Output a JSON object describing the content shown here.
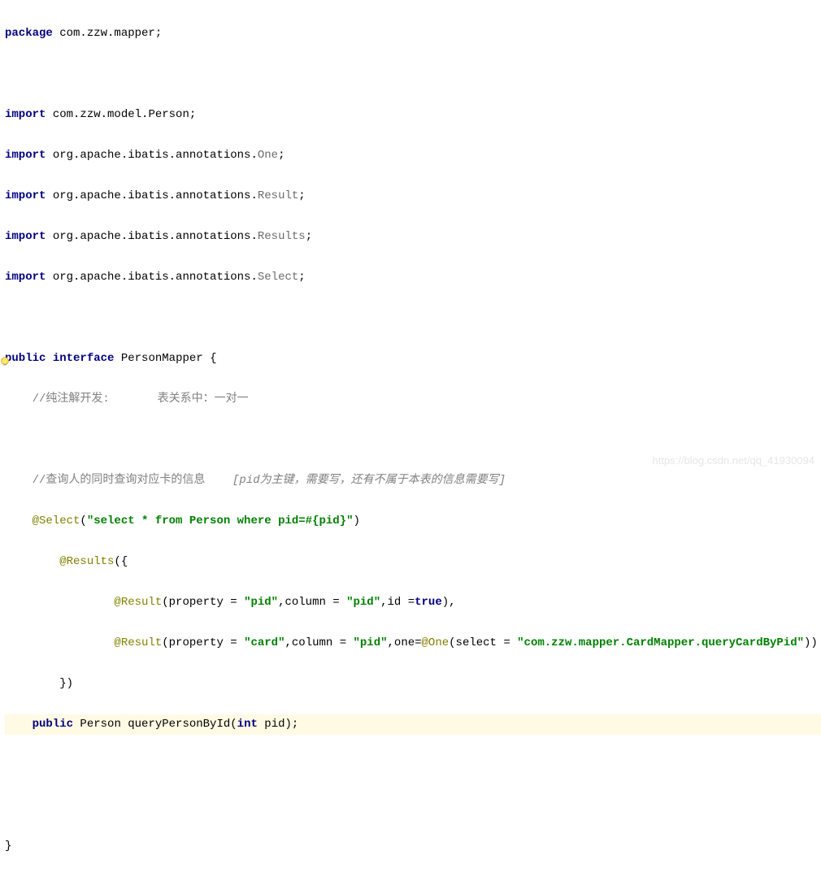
{
  "code": {
    "l1_kw": "package",
    "l1_rest": " com.zzw.mapper;",
    "l3_kw": "import",
    "l3_rest": " com.zzw.model.Person;",
    "l4_kw": "import",
    "l4_rest": " org.apache.ibatis.annotations.",
    "l4_cls": "One",
    "l5_kw": "import",
    "l5_rest": " org.apache.ibatis.annotations.",
    "l5_cls": "Result",
    "l6_kw": "import",
    "l6_rest": " org.apache.ibatis.annotations.",
    "l6_cls": "Results",
    "l7_kw": "import",
    "l7_rest": " org.apache.ibatis.annotations.",
    "l7_cls": "Select",
    "l9_kw1": "public",
    "l9_kw2": "interface",
    "l9_rest": " PersonMapper {",
    "l10_comment": "    //纯注解开发:       表关系中：一对一",
    "l12_comment": "    //查询人的同时查询对应卡的信息    ",
    "l12_comment_it": "[pid为主键，需要写，还有不属于本表的信息需要写]",
    "l13_ann": "    @Select",
    "l13_p1": "(",
    "l13_str": "\"select * from Person where pid=#{pid}\"",
    "l13_p2": ")",
    "l14_ann": "        @Results",
    "l14_rest": "({",
    "l15_ann": "                @Result",
    "l15_a": "(property = ",
    "l15_s1": "\"pid\"",
    "l15_b": ",column = ",
    "l15_s2": "\"pid\"",
    "l15_c": ",id =",
    "l15_true": "true",
    "l15_d": "),",
    "l16_ann": "                @Result",
    "l16_a": "(property = ",
    "l16_s1": "\"card\"",
    "l16_b": ",column = ",
    "l16_s2": "\"pid\"",
    "l16_c": ",one=",
    "l16_ann2": "@One",
    "l16_d": "(select = ",
    "l16_s3": "\"com.zzw.mapper.CardMapper.queryCardByPid\"",
    "l16_e": "))",
    "l17": "        })",
    "l18_a": "    ",
    "l18_kw1": "public",
    "l18_b": " Person queryPersonById(",
    "l18_kw2": "int",
    "l18_c": " pid);",
    "l21": "}"
  },
  "watermark": "https://blog.csdn.net/qq_41930094"
}
